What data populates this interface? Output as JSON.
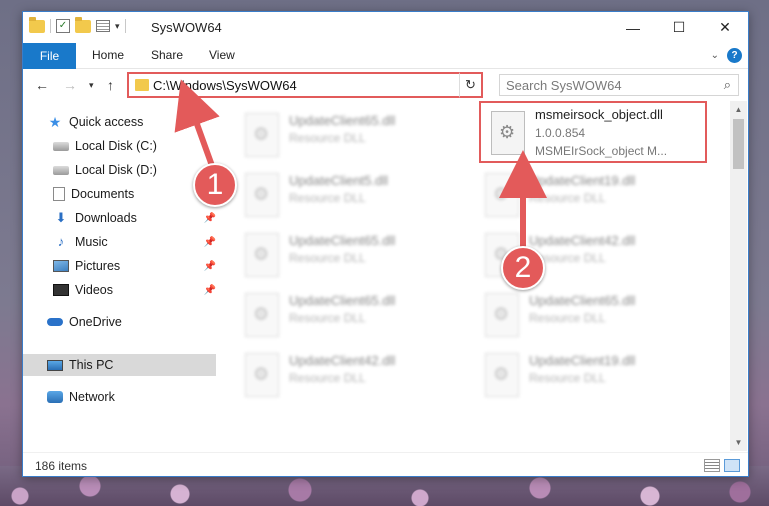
{
  "window": {
    "title": "SysWOW64"
  },
  "titlebar": {
    "minimize": "—",
    "maximize": "☐",
    "close": "✕"
  },
  "ribbon": {
    "tabs": [
      {
        "label": "File"
      },
      {
        "label": "Home"
      },
      {
        "label": "Share"
      },
      {
        "label": "View"
      }
    ]
  },
  "address": {
    "path": "C:\\Windows\\SysWOW64"
  },
  "search": {
    "placeholder": "Search SysWOW64"
  },
  "nav": {
    "items": [
      {
        "label": "Quick access"
      },
      {
        "label": "Local Disk (C:)"
      },
      {
        "label": "Local Disk (D:)"
      },
      {
        "label": "Documents"
      },
      {
        "label": "Downloads"
      },
      {
        "label": "Music"
      },
      {
        "label": "Pictures"
      },
      {
        "label": "Videos"
      },
      {
        "label": "OneDrive"
      },
      {
        "label": "This PC"
      },
      {
        "label": "Network"
      }
    ]
  },
  "files": [
    {
      "name": "UpdateClient65.dll",
      "type": "Resource DLL"
    },
    {
      "name": "msmeirsock_object.dll",
      "version": "1.0.0.854",
      "description": "MSMEIrSock_object M..."
    },
    {
      "name": "UpdateClient5.dll",
      "type": "Resource DLL"
    },
    {
      "name": "UpdateClient19.dll",
      "type": "Resource DLL"
    },
    {
      "name": "UpdateClient65.dll",
      "type": "Resource DLL"
    },
    {
      "name": "UpdateClient42.dll",
      "type": "Resource DLL"
    },
    {
      "name": "UpdateClient65.dll",
      "type": "Resource DLL"
    },
    {
      "name": "UpdateClient65.dll",
      "type": "Resource DLL"
    },
    {
      "name": "UpdateClient42.dll",
      "type": "Resource DLL"
    },
    {
      "name": "UpdateClient19.dll",
      "type": "Resource DLL"
    }
  ],
  "status": {
    "item_count": "186 items"
  },
  "annotations": {
    "step1": "1",
    "step2": "2",
    "color": "#e35a5a"
  }
}
